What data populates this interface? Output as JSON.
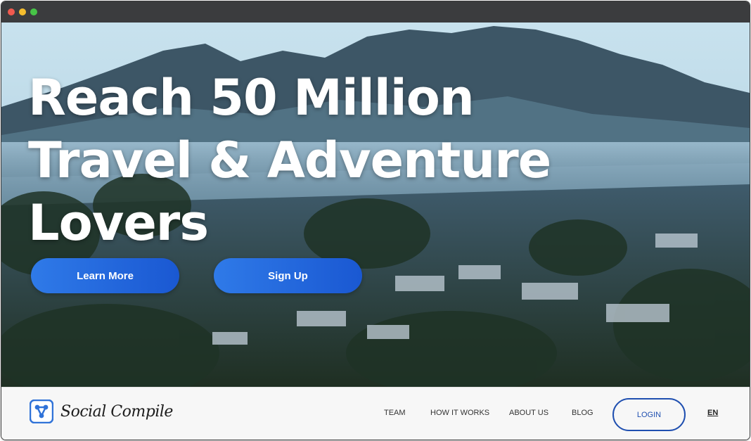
{
  "hero": {
    "headline_lines": [
      "Reach 50 Million",
      "Travel & Adventure",
      "Lovers"
    ],
    "learn_more_label": "Learn More",
    "sign_up_label": "Sign Up",
    "button_color_start": "#2f7ae8",
    "button_color_end": "#1a58d2"
  },
  "navbar": {
    "logo_text": "Social Compile",
    "items": [
      {
        "label": "TEAM"
      },
      {
        "label": "HOW IT WORKS"
      },
      {
        "label": "ABOUT US"
      },
      {
        "label": "BLOG"
      }
    ],
    "login_label": "LOGIN",
    "language_label": "EN",
    "accent_color": "#1f4fb0"
  },
  "icons": {
    "logo": "share-nodes-icon"
  }
}
